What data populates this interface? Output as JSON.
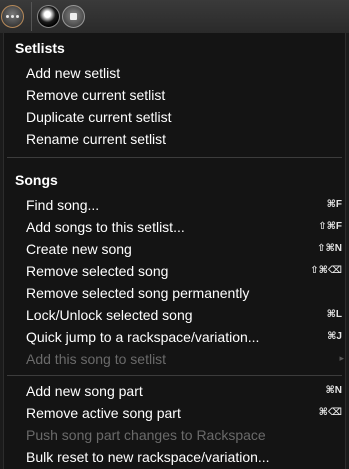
{
  "toolbar": {
    "buttons": [
      {
        "icon": "more-icon"
      },
      {
        "icon": "record-ball-icon"
      },
      {
        "icon": "stop-icon"
      }
    ]
  },
  "menu": {
    "setlists": {
      "title": "Setlists",
      "items": [
        {
          "label": "Add new setlist"
        },
        {
          "label": "Remove current setlist"
        },
        {
          "label": "Duplicate current setlist"
        },
        {
          "label": "Rename current setlist"
        }
      ]
    },
    "songs": {
      "title": "Songs",
      "items": [
        {
          "label": "Find song...",
          "shortcut": "⌘F"
        },
        {
          "label": "Add songs to this setlist...",
          "shortcut": "⇧⌘F"
        },
        {
          "label": "Create new song",
          "shortcut": "⇧⌘N"
        },
        {
          "label": "Remove selected song",
          "shortcut": "⇧⌘⌫"
        },
        {
          "label": "Remove selected song permanently",
          "shortcut": ""
        },
        {
          "label": "Lock/Unlock selected song",
          "shortcut": "⌘L"
        },
        {
          "label": "Quick jump to a rackspace/variation...",
          "shortcut": "⌘J"
        },
        {
          "label": "Add this song to setlist",
          "shortcut": "▸"
        }
      ]
    },
    "parts": {
      "items": [
        {
          "label": "Add new song part",
          "shortcut": "⌘N"
        },
        {
          "label": "Remove active song part",
          "shortcut": "⌘⌫"
        },
        {
          "label": "Push song part changes to Rackspace",
          "shortcut": ""
        },
        {
          "label": "Bulk reset to new rackspace/variation...",
          "shortcut": ""
        }
      ]
    }
  }
}
